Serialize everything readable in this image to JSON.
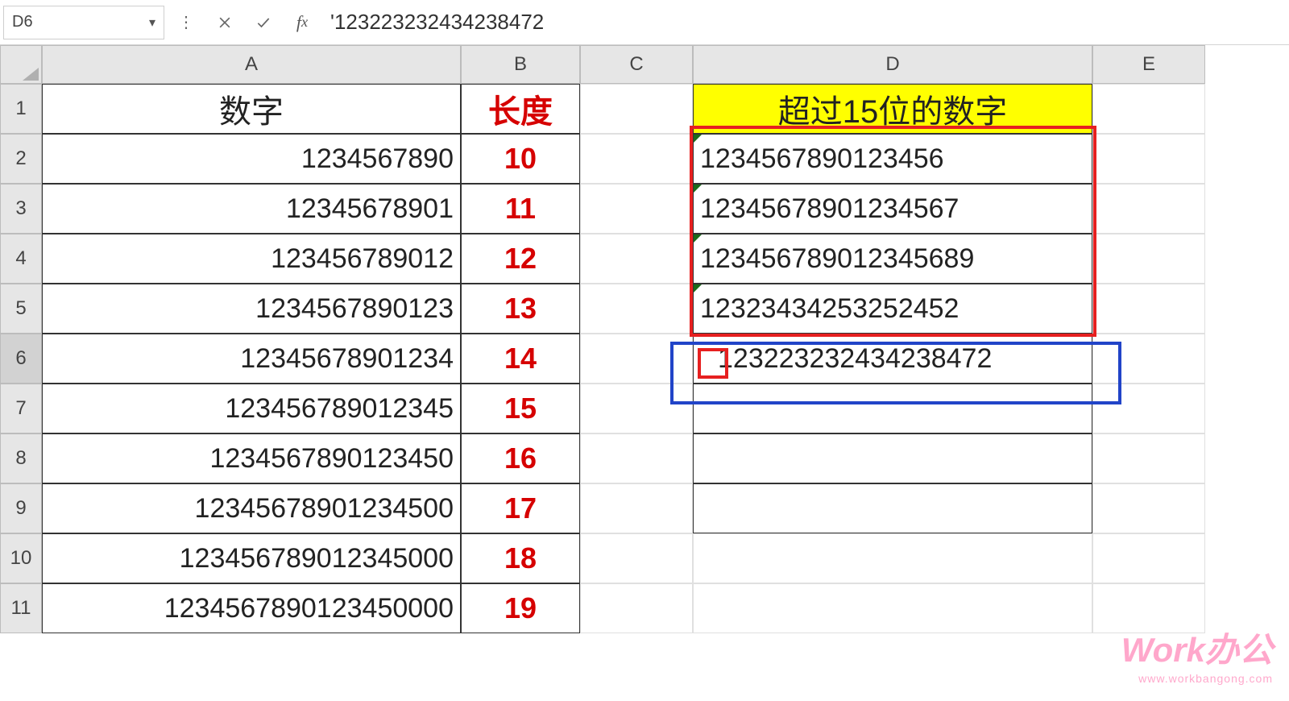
{
  "formulaBar": {
    "nameBox": "D6",
    "formula": "'123223232434238472"
  },
  "columns": [
    "A",
    "B",
    "C",
    "D",
    "E"
  ],
  "rowHeaders": [
    "1",
    "2",
    "3",
    "4",
    "5",
    "6",
    "7",
    "8",
    "9",
    "10",
    "11"
  ],
  "headers": {
    "A": "数字",
    "B": "长度",
    "D": "超过15位的数字"
  },
  "colA": [
    "1234567890",
    "12345678901",
    "123456789012",
    "1234567890123",
    "12345678901234",
    "123456789012345",
    "1234567890123450",
    "12345678901234500",
    "123456789012345000",
    "1234567890123450000"
  ],
  "colB": [
    "10",
    "11",
    "12",
    "13",
    "14",
    "15",
    "16",
    "17",
    "18",
    "19"
  ],
  "colD": [
    "1234567890123456",
    "12345678901234567",
    "123456789012345689",
    "12323434253252452",
    "123223232434238472"
  ],
  "watermark": {
    "brand": "Work办公",
    "url": "www.workbangong.com"
  }
}
